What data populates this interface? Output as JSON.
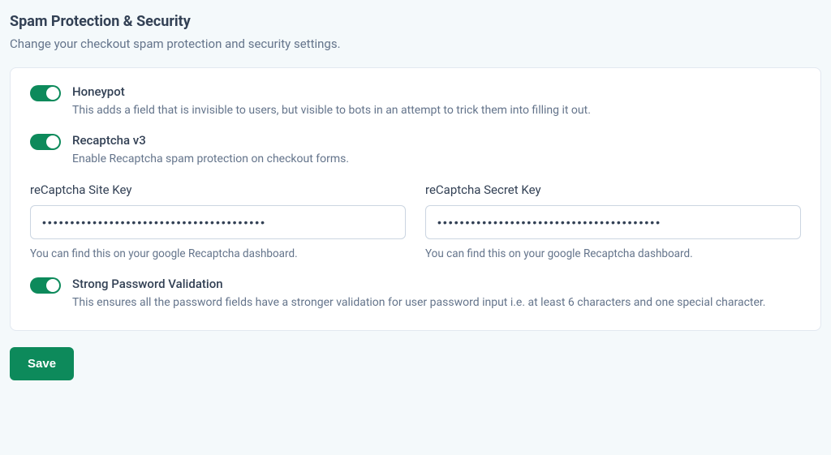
{
  "header": {
    "title": "Spam Protection & Security",
    "subtitle": "Change your checkout spam protection and security settings."
  },
  "settings": {
    "honeypot": {
      "label": "Honeypot",
      "description": "This adds a field that is invisible to users, but visible to bots in an attempt to trick them into filling it out.",
      "enabled": true
    },
    "recaptcha": {
      "label": "Recaptcha v3",
      "description": "Enable Recaptcha spam protection on checkout forms.",
      "enabled": true
    },
    "siteKey": {
      "label": "reCaptcha Site Key",
      "value": "••••••••••••••••••••••••••••••••••••••••",
      "hint": "You can find this on your google Recaptcha dashboard."
    },
    "secretKey": {
      "label": "reCaptcha Secret Key",
      "value": "••••••••••••••••••••••••••••••••••••••••",
      "hint": "You can find this on your google Recaptcha dashboard."
    },
    "strongPassword": {
      "label": "Strong Password Validation",
      "description": "This ensures all the password fields have a stronger validation for user password input i.e. at least 6 characters and one special character.",
      "enabled": true
    }
  },
  "actions": {
    "saveLabel": "Save"
  }
}
